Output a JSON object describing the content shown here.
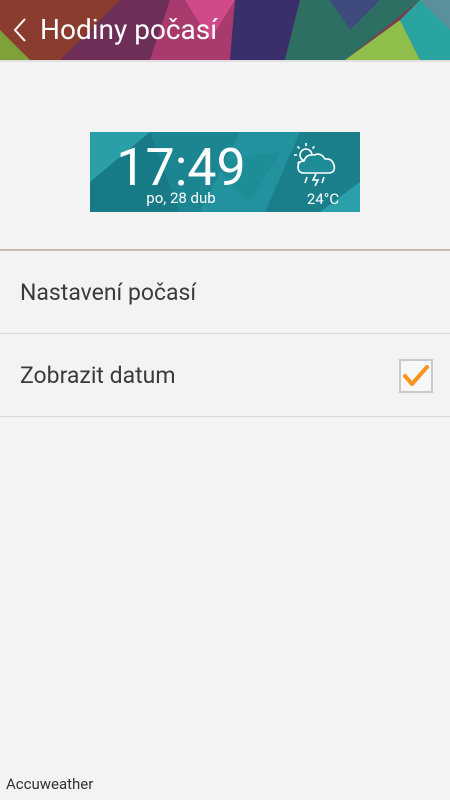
{
  "header": {
    "title": "Hodiny počasí",
    "back_icon": "chevron-left-icon"
  },
  "widget": {
    "time": "17:49",
    "date": "po, 28 dub",
    "temperature": "24°C",
    "weather_icon": "sun-cloud-thunder-icon"
  },
  "settings": {
    "items": [
      {
        "label": "Nastavení počasí"
      },
      {
        "label": "Zobrazit datum",
        "checked": true
      }
    ]
  },
  "footer": {
    "text": "Accuweather"
  },
  "colors": {
    "accent_check": "#f7941d",
    "divider": "#c4bcad",
    "widget_teal": "#1f8d98",
    "background": "#f3f3f3"
  }
}
